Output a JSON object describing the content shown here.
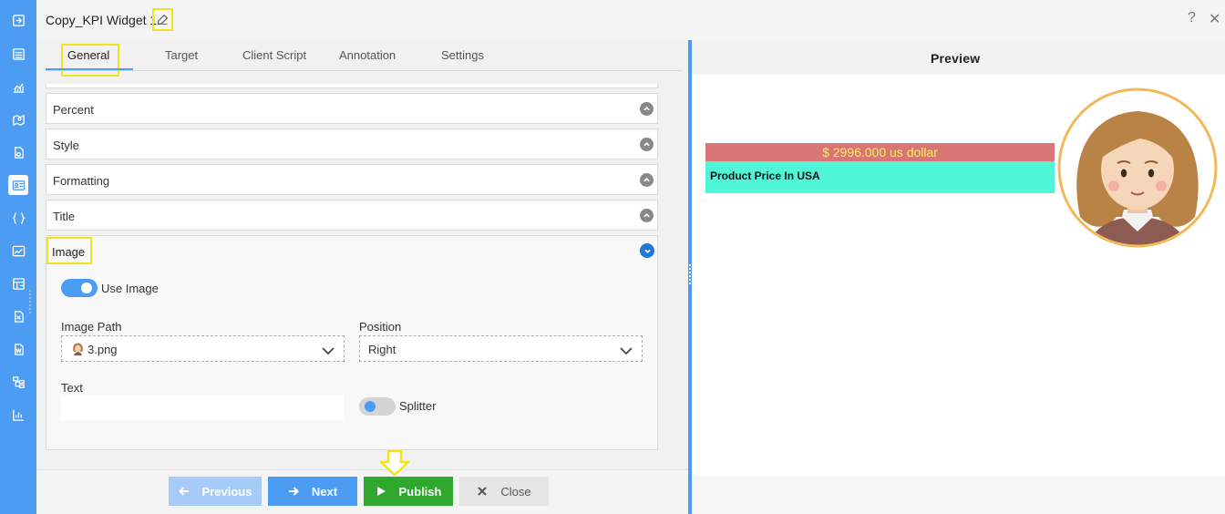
{
  "window": {
    "title": "Copy_KPI Widget 1",
    "edit_icon": "pencil-edit-icon",
    "help_label": "?",
    "close_label": "✕"
  },
  "rail": {
    "icons": [
      "sign-in-icon",
      "list-icon",
      "line-chart-icon",
      "map-icon",
      "document-icon",
      "id-card-icon",
      "braces-icon",
      "image-chart-icon",
      "table-icon",
      "excel-icon",
      "word-icon",
      "tree-icon",
      "bar-chart-icon"
    ],
    "active_index": 5
  },
  "tabs": [
    {
      "label": "General",
      "active": true
    },
    {
      "label": "Target",
      "active": false
    },
    {
      "label": "Client Script",
      "active": false
    },
    {
      "label": "Annotation",
      "active": false
    },
    {
      "label": "Settings",
      "active": false
    }
  ],
  "sections": [
    {
      "label": "Percent",
      "expanded": false
    },
    {
      "label": "Style",
      "expanded": false
    },
    {
      "label": "Formatting",
      "expanded": false
    },
    {
      "label": "Title",
      "expanded": false
    }
  ],
  "image_section": {
    "label": "Image",
    "expanded": true,
    "use_image": {
      "label": "Use Image",
      "on": true
    },
    "image_path": {
      "label": "Image Path",
      "value": "3.png"
    },
    "position": {
      "label": "Position",
      "value": "Right"
    },
    "text": {
      "label": "Text",
      "value": ""
    },
    "splitter": {
      "label": "Splitter",
      "on": false
    }
  },
  "footer": {
    "previous_label": "Previous",
    "next_label": "Next",
    "publish_label": "Publish",
    "close_label": "Close"
  },
  "preview": {
    "title": "Preview",
    "kpi_value": "$ 2996.000 us dollar",
    "kpi_label": "Product Price In USA"
  },
  "colors": {
    "accent": "#4d9cf4",
    "publish": "#2ea92e",
    "highlight": "#f2e41a",
    "kpi_value_bg": "#d87676",
    "kpi_value_text": "#f7ef55",
    "kpi_label_bg": "#4ef5d7"
  }
}
